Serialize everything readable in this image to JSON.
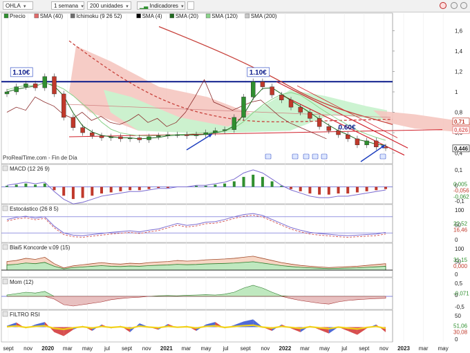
{
  "toolbar": {
    "ticker": "OHLA",
    "period": "1 semana",
    "units": "200 unidades",
    "indicators": "Indicadores"
  },
  "legend": [
    {
      "name": "Precio",
      "color": "#2f8f2f"
    },
    {
      "name": "SMA (40)",
      "color": "#e06a6a"
    },
    {
      "name": "Ichimoku (9 26 52)",
      "color": "#6f6f6f"
    },
    {
      "name": "SMA (4)",
      "color": "#000000"
    },
    {
      "name": "SMA (20)",
      "color": "#1f6a1f"
    },
    {
      "name": "SMA (120)",
      "color": "#8bd38b"
    },
    {
      "name": "SMA (200)",
      "color": "#c8c8c8"
    }
  ],
  "source_label": "ProRealTime.com - Fin de Día",
  "colors": {
    "up": "#2f8f2f",
    "down": "#c0392b",
    "cloud_red": "#f5c6c0",
    "cloud_green": "#c9f2cf",
    "resistance": "#0a1a8a",
    "channel": "#d0202a",
    "arrow": "#1e3fbf"
  },
  "chart_data": [
    {
      "type": "line",
      "name": "price",
      "ylim": [
        0.35,
        1.65
      ],
      "yticks": [
        "1,6",
        "1,4",
        "1,2",
        "1",
        "0,8",
        "0,6",
        "0,4"
      ],
      "ytick_values": [
        1.6,
        1.4,
        1.2,
        1.0,
        0.8,
        0.6,
        0.4
      ],
      "right_tags": [
        {
          "text": "0,71",
          "value": 0.71,
          "color": "#c0392b"
        },
        {
          "text": "0,626",
          "value": 0.626,
          "color": "#e06a6a"
        },
        {
          "text": "0,446",
          "value": 0.446,
          "color": "#222222"
        }
      ],
      "annotations": [
        {
          "text": "1.10€",
          "x": 0.6,
          "y": 1.17
        },
        {
          "text": "1.10€",
          "x": 25.6,
          "y": 1.17
        },
        {
          "text": "0.60€",
          "x": 35.0,
          "y": 0.63
        }
      ],
      "resistance": 1.1,
      "x_month_index": [
        0,
        1,
        2,
        3,
        4,
        5,
        6,
        7,
        8,
        9,
        10,
        11,
        12,
        13,
        14,
        15,
        16,
        17,
        18,
        19,
        20,
        21,
        22,
        23,
        24,
        25,
        26,
        27,
        28,
        29,
        30,
        31,
        32,
        33,
        34,
        35,
        36,
        37,
        38,
        39,
        40,
        41,
        42,
        43,
        44,
        45
      ],
      "close": [
        1.0,
        1.05,
        1.08,
        1.04,
        1.15,
        0.98,
        0.75,
        0.65,
        0.6,
        0.57,
        0.55,
        0.56,
        0.54,
        0.55,
        0.53,
        0.56,
        0.57,
        0.58,
        0.58,
        0.57,
        0.58,
        0.6,
        0.62,
        0.63,
        0.75,
        0.95,
        1.1,
        1.05,
        0.97,
        0.92,
        0.85,
        0.8,
        0.74,
        0.66,
        0.62,
        0.58,
        0.54,
        0.48,
        0.52,
        0.46,
        0.45
      ]
    },
    {
      "type": "bar",
      "name": "MACD (12 26 9)",
      "yticks": [
        "0,1",
        "0",
        "-0,1"
      ],
      "right_tags": [
        "0,005",
        "-0,056",
        "-0,062"
      ],
      "values": [
        0.01,
        0.02,
        0.03,
        0.02,
        0.03,
        -0.03,
        -0.08,
        -0.11,
        -0.1,
        -0.08,
        -0.06,
        -0.05,
        -0.04,
        -0.03,
        -0.03,
        -0.02,
        -0.01,
        -0.01,
        0.0,
        0.0,
        0.01,
        0.01,
        0.02,
        0.03,
        0.05,
        0.09,
        0.11,
        0.09,
        0.05,
        0.01,
        -0.02,
        -0.04,
        -0.06,
        -0.07,
        -0.07,
        -0.06,
        -0.06,
        -0.05,
        -0.04,
        -0.03,
        -0.02
      ]
    },
    {
      "type": "line",
      "name": "Estocástico (26 8 5)",
      "yticks": [
        "100",
        "50",
        "0"
      ],
      "right_tags": [
        "22,52",
        "16,46"
      ],
      "values": [
        70,
        78,
        82,
        75,
        80,
        45,
        20,
        12,
        10,
        14,
        18,
        22,
        25,
        28,
        24,
        30,
        35,
        45,
        55,
        48,
        52,
        60,
        62,
        70,
        80,
        88,
        92,
        85,
        70,
        55,
        40,
        30,
        22,
        18,
        15,
        12,
        10,
        12,
        14,
        16,
        22
      ]
    },
    {
      "type": "area",
      "name": "Blai5 Koncorde v.09 (15)",
      "yticks": [
        "100",
        "50",
        "0"
      ],
      "right_tags": [
        "31,15",
        "0,000"
      ],
      "values": [
        40,
        45,
        55,
        50,
        60,
        30,
        10,
        20,
        25,
        30,
        35,
        30,
        28,
        32,
        30,
        35,
        38,
        40,
        45,
        42,
        44,
        48,
        50,
        52,
        55,
        60,
        65,
        55,
        45,
        35,
        28,
        22,
        18,
        15,
        12,
        14,
        16,
        18,
        22,
        26,
        30
      ]
    },
    {
      "type": "area",
      "name": "Mom (12)",
      "yticks": [
        "0,5",
        "0",
        "-0,5"
      ],
      "right_tags": [
        "-0,071"
      ],
      "values": [
        0.05,
        0.1,
        0.15,
        0.12,
        0.18,
        -0.1,
        -0.3,
        -0.35,
        -0.3,
        -0.25,
        -0.2,
        -0.12,
        -0.08,
        -0.05,
        -0.03,
        0.0,
        0.02,
        0.03,
        0.02,
        0.04,
        0.05,
        0.06,
        0.05,
        0.08,
        0.15,
        0.3,
        0.4,
        0.3,
        0.15,
        0.02,
        -0.08,
        -0.15,
        -0.2,
        -0.25,
        -0.28,
        -0.2,
        -0.15,
        -0.12,
        -0.1,
        -0.08,
        -0.07
      ]
    },
    {
      "type": "line",
      "name": "FILTRO RSI",
      "yticks": [
        "50",
        "0"
      ],
      "right_tags": [
        "51,06",
        "30,08"
      ],
      "values": [
        55,
        68,
        45,
        60,
        70,
        30,
        15,
        40,
        55,
        35,
        60,
        45,
        55,
        30,
        65,
        50,
        40,
        62,
        48,
        55,
        35,
        60,
        70,
        45,
        58,
        72,
        80,
        50,
        35,
        60,
        45,
        30,
        55,
        40,
        25,
        50,
        35,
        20,
        45,
        60,
        30
      ]
    }
  ],
  "x_axis": {
    "labels": [
      "sept",
      "nov",
      "2020",
      "mar",
      "may",
      "jul",
      "sept",
      "nov",
      "2021",
      "mar",
      "may",
      "jul",
      "sept",
      "nov",
      "2022",
      "mar",
      "may",
      "jul",
      "sept",
      "nov",
      "2023",
      "mar",
      "may"
    ],
    "bold": [
      "2020",
      "2021",
      "2022",
      "2023"
    ]
  }
}
